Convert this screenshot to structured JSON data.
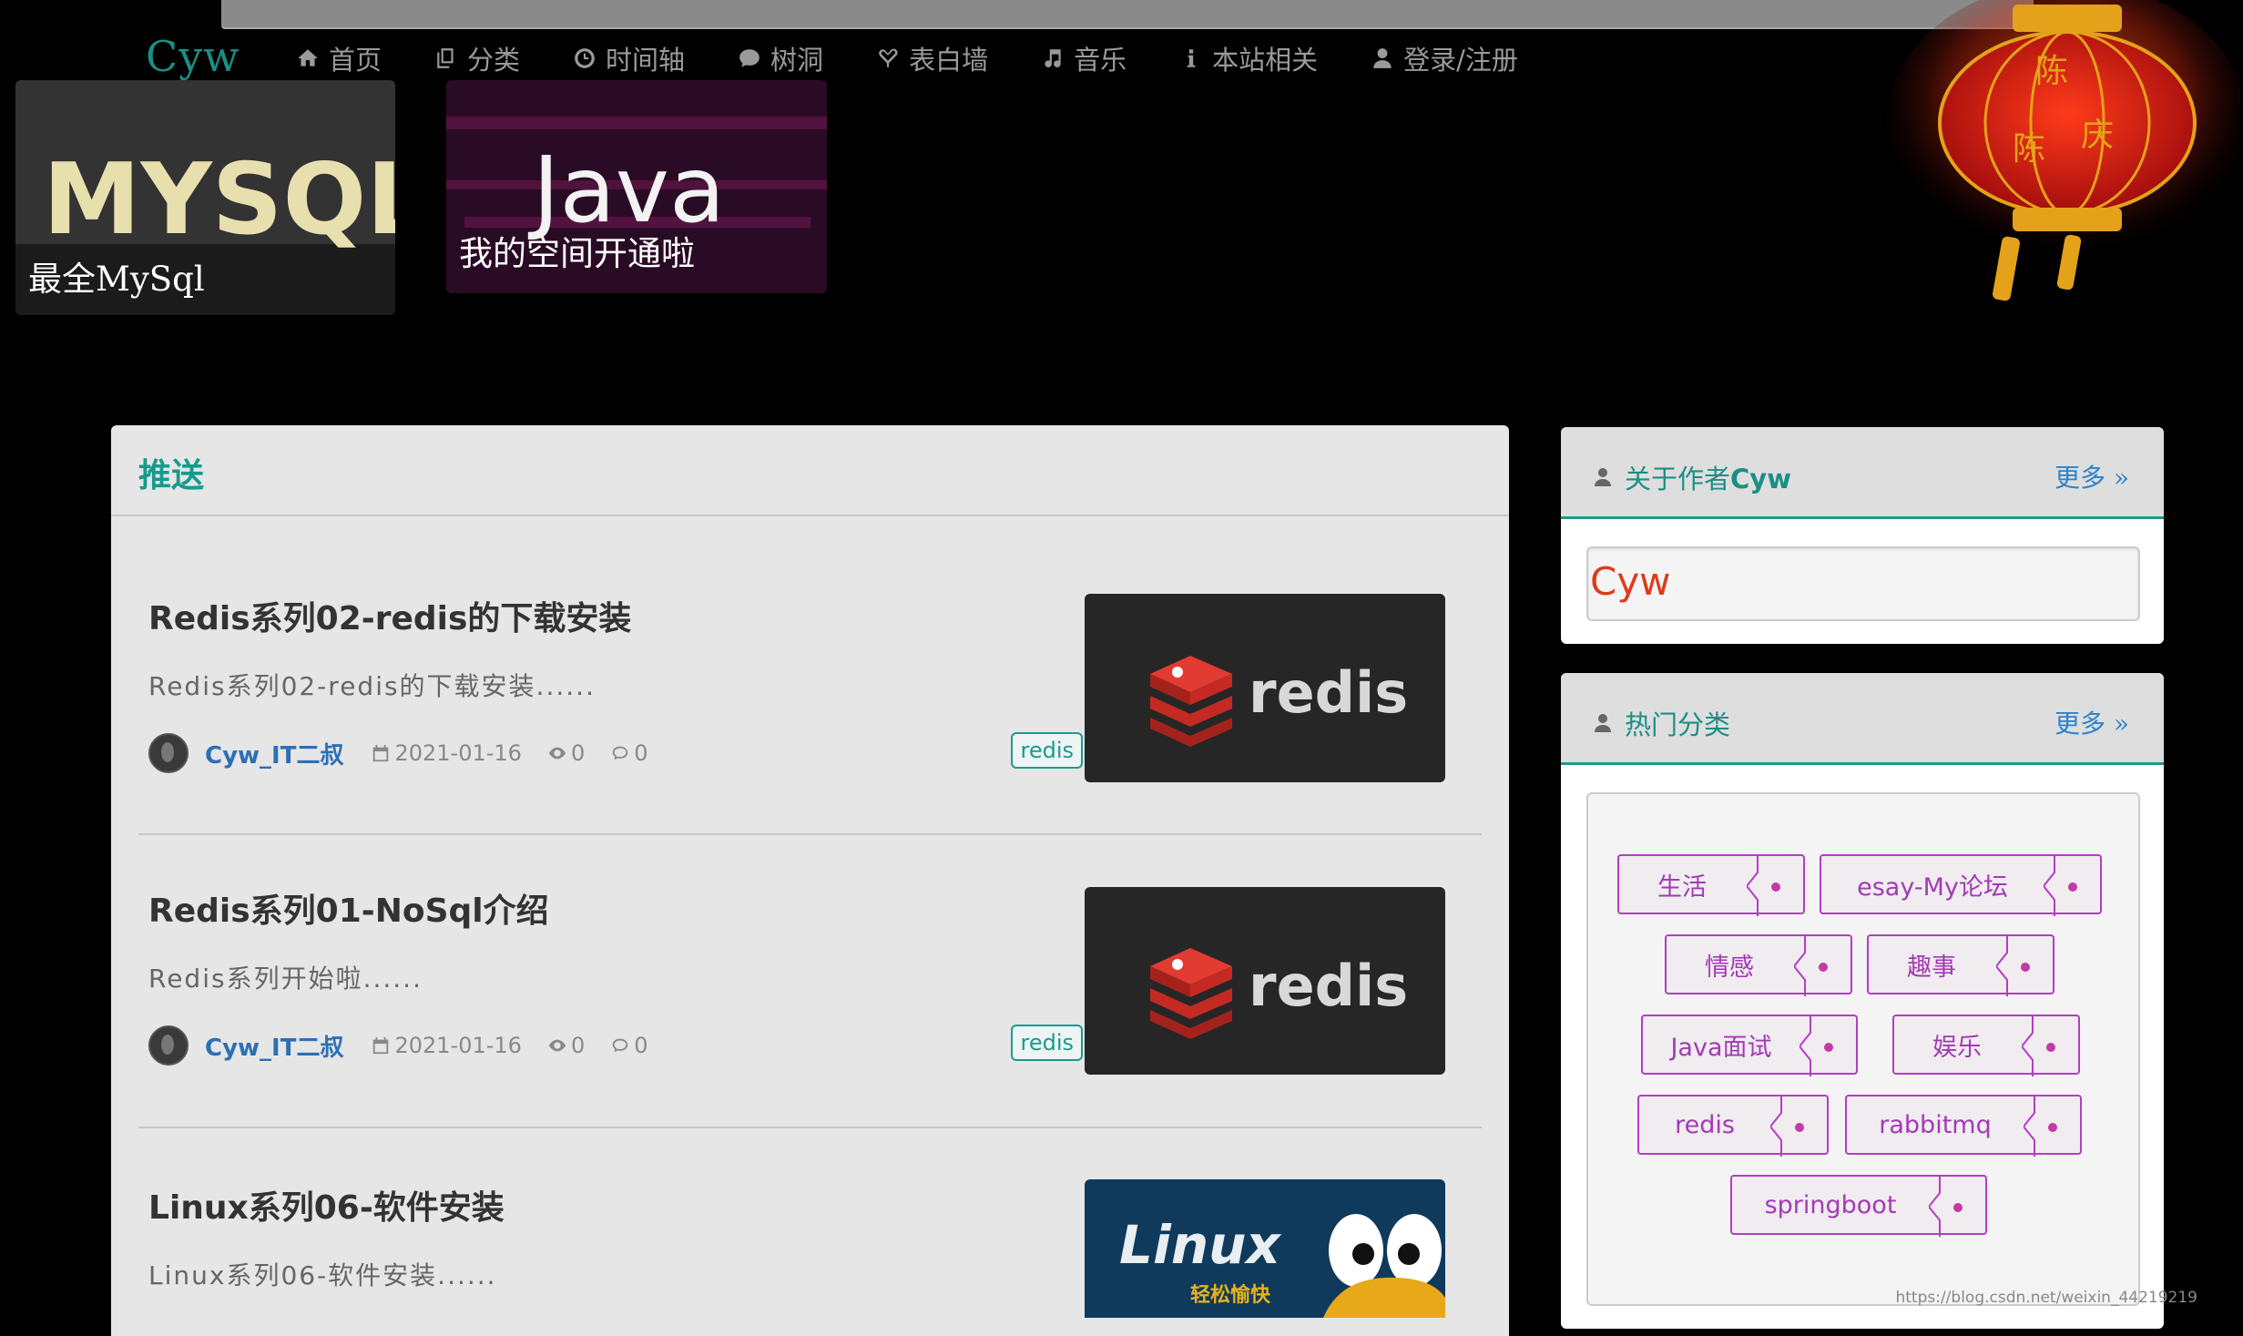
{
  "header": {
    "logo": "Cyw",
    "nav": [
      {
        "label": "首页",
        "icon": "home-icon"
      },
      {
        "label": "分类",
        "icon": "copy-icon"
      },
      {
        "label": "时间轴",
        "icon": "clock-icon"
      },
      {
        "label": "树洞",
        "icon": "comment-icon"
      },
      {
        "label": "表白墙",
        "icon": "heart-icon"
      },
      {
        "label": "音乐",
        "icon": "music-icon"
      },
      {
        "label": "本站相关",
        "icon": "info-icon"
      },
      {
        "label": "登录/注册",
        "icon": "user-icon"
      }
    ],
    "lantern_text": [
      "陈",
      "陈",
      "庆"
    ]
  },
  "featured": [
    {
      "image_text": "MYSQL",
      "caption": "最全MySql"
    },
    {
      "image_text": "Java",
      "caption": "我的空间开通啦"
    }
  ],
  "main": {
    "title": "推送",
    "posts": [
      {
        "title": "Redis系列02-redis的下载安装",
        "excerpt": "Redis系列02-redis的下载安装......",
        "author": "Cyw_IT二叔",
        "date": "2021-01-16",
        "views": "0",
        "comments": "0",
        "tag": "redis",
        "image_text": "redis"
      },
      {
        "title": "Redis系列01-NoSql介绍",
        "excerpt": "Redis系列开始啦......",
        "author": "Cyw_IT二叔",
        "date": "2021-01-16",
        "views": "0",
        "comments": "0",
        "tag": "redis",
        "image_text": "redis"
      },
      {
        "title": "Linux系列06-软件安装",
        "excerpt": "Linux系列06-软件安装......",
        "image_text": "Linux",
        "image_subtext": "轻松愉快"
      }
    ]
  },
  "sidebar": {
    "about": {
      "title_prefix": "关于作者",
      "title_name": "Cyw",
      "more": "更多",
      "name": "Cyw"
    },
    "categories": {
      "title": "热门分类",
      "more": "更多",
      "tags": [
        "生活",
        "esay-My论坛",
        "情感",
        "趣事",
        "Java面试",
        "娱乐",
        "redis",
        "rabbitmq",
        "springboot"
      ]
    }
  },
  "watermark": "https://blog.csdn.net/weixin_44219219"
}
